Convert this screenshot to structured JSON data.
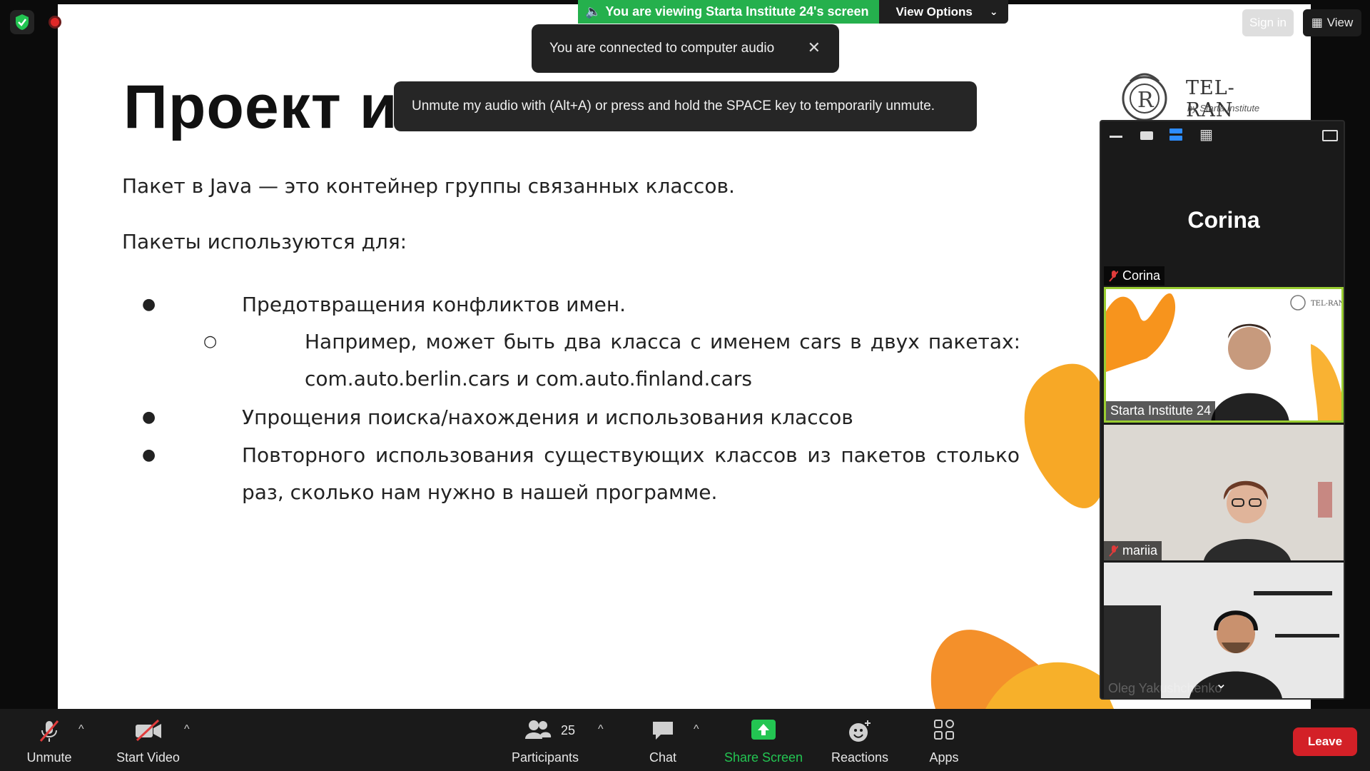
{
  "meeting": {
    "banner_text": "You are viewing Starta Institute 24's screen",
    "view_options_label": "View Options",
    "toast_audio_connected": "You are connected to computer audio",
    "toast_unmute_hint": "Unmute my audio with (Alt+A) or press and hold the SPACE key to temporarily unmute.",
    "sign_in_label": "Sign in",
    "view_label": "View"
  },
  "slide": {
    "title": "Проект и пакет",
    "intro": "Пакет в Java — это контейнер группы связанных классов.",
    "uses_heading": "Пакеты используются для:",
    "bullets": [
      "Предотвращения конфликтов имен.",
      "Например, может быть два класса с именем cars в двух пакетах: com.auto.berlin.cars и com.auto.finland.cars",
      "Упрощения поиска/нахождения и использования классов",
      "Повторного использования существующих классов из пакетов столько раз, сколько нам нужно в нашей программе."
    ],
    "logo_name": "TEL-RAN",
    "logo_sub": "by Starta Institute",
    "accent_color": "#f7941d"
  },
  "gallery": {
    "participants": [
      {
        "name": "Corina",
        "muted": true,
        "video": false
      },
      {
        "name": "Starta Institute 24",
        "muted": false,
        "video": true,
        "active_speaker": true
      },
      {
        "name": "mariia",
        "muted": true,
        "video": true
      },
      {
        "name": "Oleg Yakushchenko",
        "muted": true,
        "video": true
      }
    ]
  },
  "toolbar": {
    "unmute_label": "Unmute",
    "start_video_label": "Start Video",
    "participants_label": "Participants",
    "participants_count": "25",
    "chat_label": "Chat",
    "share_screen_label": "Share Screen",
    "reactions_label": "Reactions",
    "apps_label": "Apps",
    "leave_label": "Leave"
  },
  "colors": {
    "share_green": "#25b04d",
    "leave_red": "#d32027",
    "speaker_border": "#9acd32"
  }
}
